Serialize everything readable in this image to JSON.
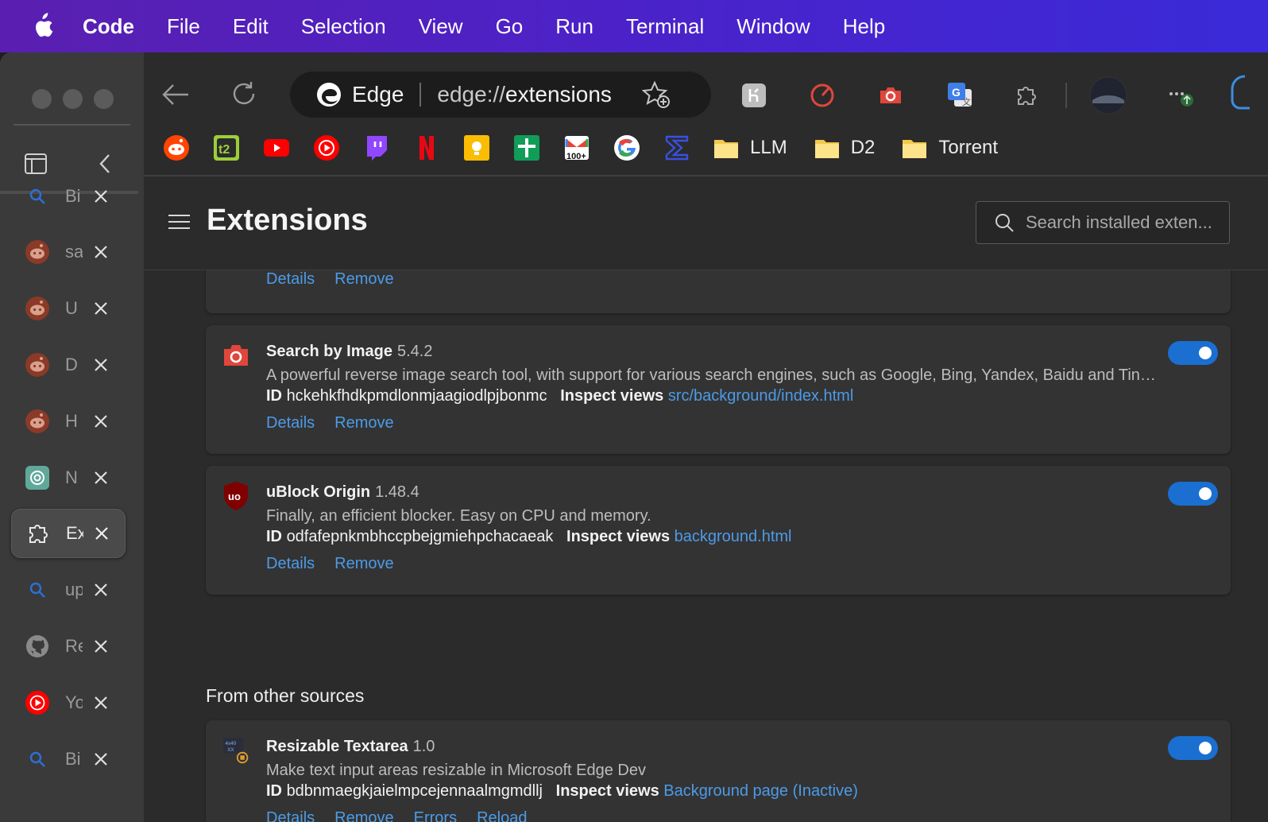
{
  "menubar": {
    "app": "Code",
    "items": [
      "File",
      "Edit",
      "Selection",
      "View",
      "Go",
      "Run",
      "Terminal",
      "Window",
      "Help"
    ]
  },
  "sidebar": {
    "tabs": [
      {
        "label": "Bi",
        "icon": "search-icon"
      },
      {
        "label": "sa",
        "icon": "reddit-icon"
      },
      {
        "label": "U",
        "icon": "reddit-icon"
      },
      {
        "label": "D",
        "icon": "reddit-icon"
      },
      {
        "label": "H",
        "icon": "reddit-icon"
      },
      {
        "label": "N",
        "icon": "chatgpt-icon"
      },
      {
        "label": "Ex",
        "icon": "extension-icon",
        "active": true
      },
      {
        "label": "up",
        "icon": "search-icon"
      },
      {
        "label": "Re",
        "icon": "github-icon"
      },
      {
        "label": "Yo",
        "icon": "youtube-music-icon"
      },
      {
        "label": "Bi",
        "icon": "search-icon"
      }
    ]
  },
  "address_bar": {
    "brand": "Edge",
    "url_scheme": "edge://",
    "url_path": "extensions"
  },
  "bookmarks": {
    "icons": [
      "reddit-icon",
      "ta-icon",
      "youtube-icon",
      "youtube-music-icon",
      "twitch-icon",
      "netflix-icon",
      "keep-icon",
      "sheets-icon",
      "gmail-icon",
      "google-icon",
      "sigma-icon"
    ],
    "folders": [
      "LLM",
      "D2",
      "Torrent"
    ]
  },
  "page": {
    "title": "Extensions",
    "search_placeholder": "Search installed exten...",
    "section_other": "From other sources"
  },
  "partial_card": {
    "actions": [
      "Details",
      "Remove"
    ]
  },
  "extensions": [
    {
      "name": "Search by Image",
      "version": "5.4.2",
      "description": "A powerful reverse image search tool, with support for various search engines, such as Google, Bing, Yandex, Baidu and TinE...",
      "id_label": "ID",
      "id": "hckehkfhdkpmdlonmjaagiodlpjbonmc",
      "inspect_label": "Inspect views",
      "inspect_link": "src/background/index.html",
      "actions": [
        "Details",
        "Remove"
      ],
      "enabled": true
    },
    {
      "name": "uBlock Origin",
      "version": "1.48.4",
      "description": "Finally, an efficient blocker. Easy on CPU and memory.",
      "id_label": "ID",
      "id": "odfafepnkmbhccpbejgmiehpchacaeak",
      "inspect_label": "Inspect views",
      "inspect_link": "background.html",
      "actions": [
        "Details",
        "Remove"
      ],
      "enabled": true
    },
    {
      "name": "Resizable Textarea",
      "version": "1.0",
      "description": "Make text input areas resizable in Microsoft Edge Dev",
      "id_label": "ID",
      "id": "bdbnmaegkjaielmpcejennaalmgmdllj",
      "inspect_label": "Inspect views",
      "inspect_link": "Background page (Inactive)",
      "actions": [
        "Details",
        "Remove",
        "Errors",
        "Reload"
      ],
      "enabled": true,
      "icon_text": "4x40 XX"
    }
  ],
  "colors": {
    "menubar_start": "#5a1fb0",
    "menubar_end": "#3a2ad8",
    "link": "#4c9be8",
    "toggle_on": "#1a6fd1"
  }
}
